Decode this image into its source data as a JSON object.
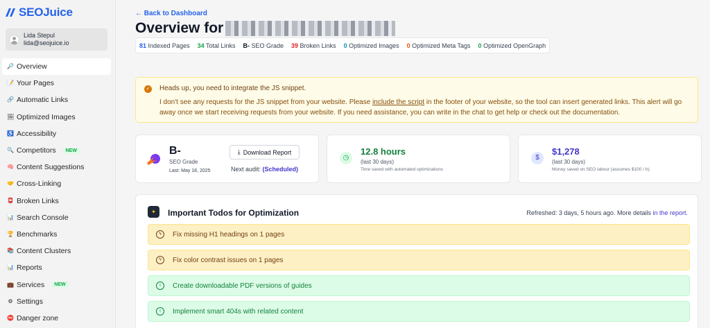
{
  "app": {
    "logo_text": "SEOJuice",
    "brand_color": "#2563eb"
  },
  "user": {
    "name": "Lida Stepul",
    "email": "lida@seojuice.io"
  },
  "sidebar": {
    "items": [
      {
        "icon": "magnifier-icon",
        "glyph": "🔎",
        "label": "Overview",
        "active": true
      },
      {
        "icon": "memo-icon",
        "glyph": "📝",
        "label": "Your Pages"
      },
      {
        "icon": "link-icon",
        "glyph": "🔗",
        "label": "Automatic Links"
      },
      {
        "icon": "picture-icon",
        "glyph": "🖼",
        "label": "Optimized Images"
      },
      {
        "icon": "wheelchair-icon",
        "glyph": "♿",
        "label": "Accessibility"
      },
      {
        "icon": "magnifier-left-icon",
        "glyph": "🔍",
        "label": "Competitors",
        "badge": "NEW"
      },
      {
        "icon": "brain-icon",
        "glyph": "🧠",
        "label": "Content Suggestions"
      },
      {
        "icon": "handshake-icon",
        "glyph": "🤝",
        "label": "Cross-Linking"
      },
      {
        "icon": "broken-link-icon",
        "glyph": "📮",
        "label": "Broken Links"
      },
      {
        "icon": "chart-icon",
        "glyph": "📊",
        "label": "Search Console"
      },
      {
        "icon": "trophy-icon",
        "glyph": "🏆",
        "label": "Benchmarks"
      },
      {
        "icon": "books-icon",
        "glyph": "📚",
        "label": "Content Clusters"
      },
      {
        "icon": "report-chart-icon",
        "glyph": "📊",
        "label": "Reports"
      },
      {
        "icon": "briefcase-icon",
        "glyph": "💼",
        "label": "Services",
        "badge": "NEW"
      },
      {
        "icon": "gear-icon",
        "glyph": "⚙",
        "label": "Settings"
      },
      {
        "icon": "no-entry-icon",
        "glyph": "⛔",
        "label": "Danger zone"
      }
    ]
  },
  "header": {
    "back_link": "← Back to Dashboard",
    "title_prefix": "Overview for"
  },
  "stats": {
    "indexed_pages": {
      "value": "81",
      "label": "Indexed Pages",
      "color": "#2563eb"
    },
    "total_links": {
      "value": "34",
      "label": "Total Links",
      "color": "#16a34a"
    },
    "seo_grade": {
      "value": "B-",
      "label": "SEO Grade",
      "color": "#111827"
    },
    "broken_links": {
      "value": "39",
      "label": "Broken Links",
      "color": "#dc2626"
    },
    "optimized_images": {
      "value": "0",
      "label": "Optimized Images",
      "color": "#0891b2"
    },
    "optimized_meta": {
      "value": "0",
      "label": "Optimized Meta Tags",
      "color": "#ea580c"
    },
    "optimized_og": {
      "value": "0",
      "label": "Optimized OpenGraph",
      "color": "#16a34a"
    }
  },
  "alert": {
    "title": "Heads up, you need to integrate the JS snippet.",
    "body_before": "I don't see any requests for the JS snippet from your website. Please ",
    "body_link": "include the script",
    "body_after": " in the footer of your website, so the tool can insert generated links. This alert will go away once we start receiving requests from your website. If you need assistance, you can write in the chat to get help or check out the documentation."
  },
  "grade_card": {
    "grade": "B-",
    "label": "SEO Grade",
    "last_audit": "Last: May 18, 2025",
    "download_label": "Download Report",
    "next_audit_label": "Next audit:",
    "next_audit_value": "(Scheduled)"
  },
  "time_card": {
    "value": "12.8 hours",
    "period": "(last 30 days)",
    "note": "Time saved with automated optimizations",
    "color": "#15803d"
  },
  "money_card": {
    "value": "$1,278",
    "period": "(last 30 days)",
    "note": "Money saved on SEO labour (assumes $100 / h).",
    "color": "#4338ca"
  },
  "todos": {
    "title": "Important Todos for Optimization",
    "refresh_text": "Refreshed: 3 days, 5 hours ago. More details ",
    "refresh_link": "in the report.",
    "items": [
      {
        "type": "warn",
        "label": "Fix missing H1 headings on 1 pages"
      },
      {
        "type": "warn",
        "label": "Fix color contrast issues on 1 pages"
      },
      {
        "type": "tip",
        "label": "Create downloadable PDF versions of guides"
      },
      {
        "type": "tip",
        "label": "Implement smart 404s with related content"
      }
    ]
  }
}
